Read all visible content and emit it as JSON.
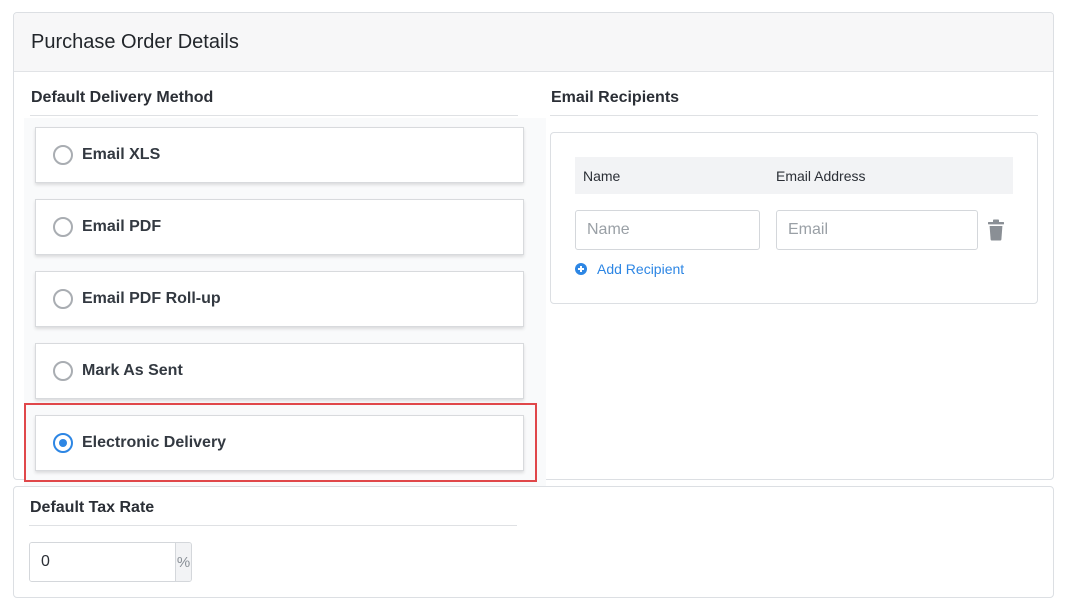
{
  "page": {
    "title": "Purchase Order Details"
  },
  "delivery": {
    "label": "Default Delivery Method",
    "options": [
      {
        "label": "Email XLS",
        "selected": false
      },
      {
        "label": "Email PDF",
        "selected": false
      },
      {
        "label": "Email PDF Roll-up",
        "selected": false
      },
      {
        "label": "Mark As Sent",
        "selected": false
      },
      {
        "label": "Electronic Delivery",
        "selected": true
      }
    ]
  },
  "recipients": {
    "label": "Email Recipients",
    "columns": [
      "Name",
      "Email Address"
    ],
    "row": {
      "name_placeholder": "Name",
      "name_value": "",
      "email_placeholder": "Email",
      "email_value": ""
    },
    "add_label": "Add Recipient"
  },
  "tax": {
    "label": "Default Tax Rate",
    "value": "0",
    "unit": "%"
  },
  "colors": {
    "accent": "#2d86e4",
    "highlight": "#e0474a"
  },
  "icons": {
    "delete": "trash-icon",
    "add": "plus-circle-icon"
  }
}
